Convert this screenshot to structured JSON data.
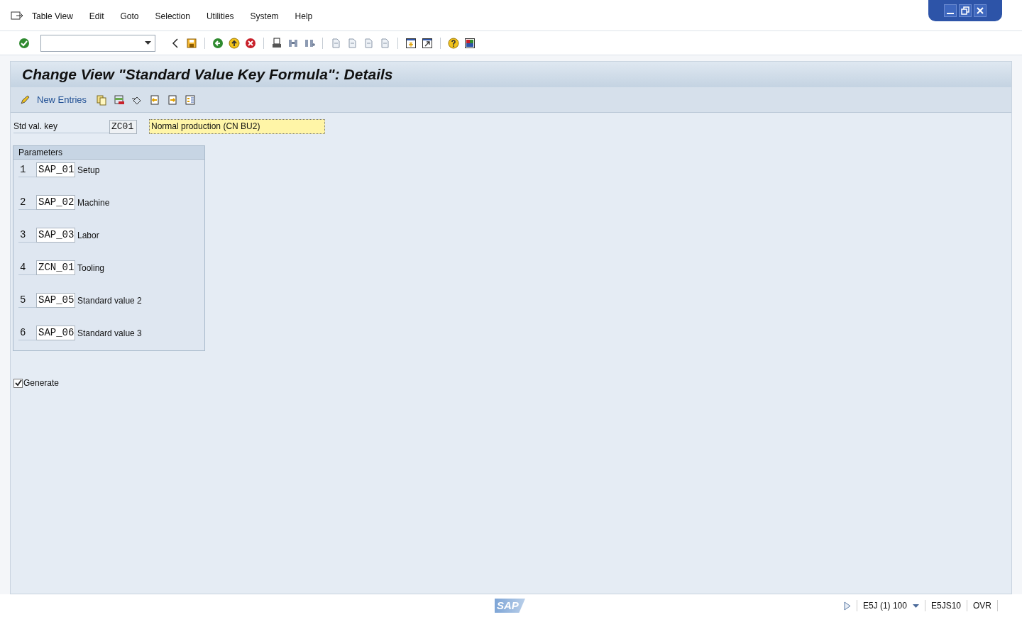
{
  "menu": [
    "Table View",
    "Edit",
    "Goto",
    "Selection",
    "Utilities",
    "System",
    "Help"
  ],
  "title": "Change View \"Standard Value Key Formula\": Details",
  "app_toolbar": {
    "new_entries": "New Entries"
  },
  "std_val_key": {
    "label": "Std val. key",
    "value": "ZC01",
    "description": "Normal production (CN BU2)"
  },
  "parameters": {
    "title": "Parameters",
    "rows": [
      {
        "number": "1",
        "key": "SAP_01",
        "text": "Setup"
      },
      {
        "number": "2",
        "key": "SAP_02",
        "text": "Machine"
      },
      {
        "number": "3",
        "key": "SAP_03",
        "text": "Labor"
      },
      {
        "number": "4",
        "key": "ZCN_01",
        "text": "Tooling"
      },
      {
        "number": "5",
        "key": "SAP_05",
        "text": "Standard value 2"
      },
      {
        "number": "6",
        "key": "SAP_06",
        "text": "Standard value 3"
      }
    ]
  },
  "generate": {
    "label": "Generate",
    "checked": true
  },
  "status_bar": {
    "logo": "SAP",
    "system": "E5J (1) 100",
    "server": "E5JS10",
    "mode": "OVR"
  }
}
